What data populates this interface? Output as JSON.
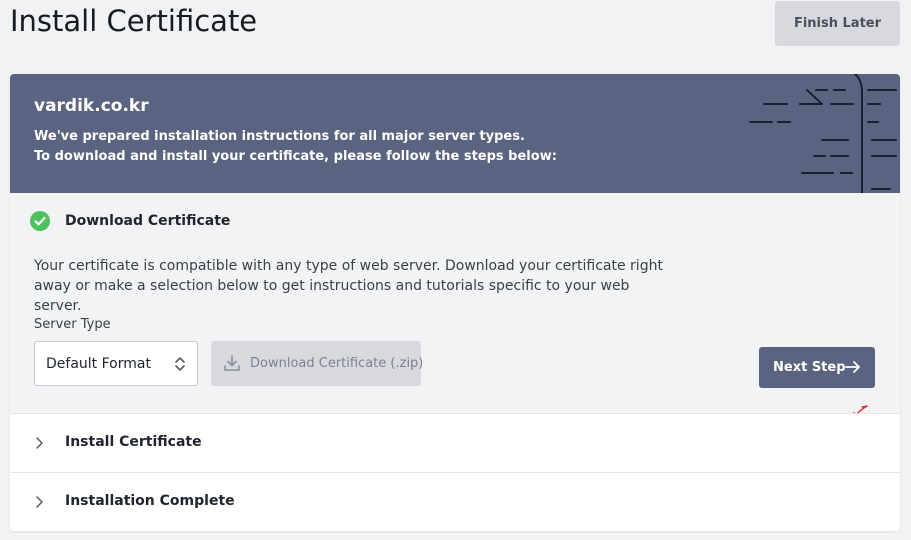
{
  "page": {
    "title": "Install Certificate",
    "finish_later_label": "Finish Later"
  },
  "banner": {
    "domain": "vardik.co.kr",
    "line1": "We've prepared installation instructions for all major server types.",
    "line2": "To download and install your certificate, please follow the steps below:"
  },
  "steps": [
    {
      "title": "Download Certificate",
      "status": "complete",
      "description": "Your certificate is compatible with any type of web server. Download your certificate right away or make a selection below to get instructions and tutorials specific to your web server.",
      "server_type_label": "Server Type",
      "server_type_value": "Default Format",
      "download_label": "Download Certificate (.zip)",
      "next_label": "Next Step"
    },
    {
      "title": "Install Certificate",
      "status": "collapsed"
    },
    {
      "title": "Installation Complete",
      "status": "collapsed"
    }
  ],
  "colors": {
    "banner": "#5a6480",
    "success": "#4cc25c",
    "next_button": "#5a6480",
    "disabled_button": "#d7d9de",
    "annotation": "#e0202a"
  },
  "icons": {
    "check": "check-circle-icon",
    "updown": "chevron-updown-icon",
    "download": "download-icon",
    "arrow": "arrow-right-icon",
    "chevron": "chevron-right-icon"
  }
}
